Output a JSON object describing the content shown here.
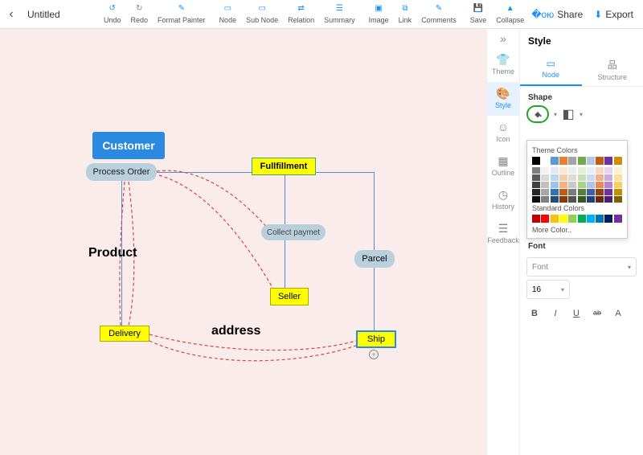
{
  "doc": {
    "title": "Untitled"
  },
  "toolbar": {
    "undo": "Undo",
    "redo": "Redo",
    "format_painter": "Format Painter",
    "node": "Node",
    "sub_node": "Sub Node",
    "relation": "Relation",
    "summary": "Summary",
    "image": "Image",
    "link": "Link",
    "comments": "Comments",
    "save": "Save",
    "collapse": "Collapse",
    "share": "Share",
    "export": "Export"
  },
  "side": {
    "theme": "Theme",
    "style": "Style",
    "icon": "Icon",
    "outline": "Outline",
    "history": "History",
    "feedback": "Feedback"
  },
  "panel": {
    "title": "Style",
    "tab_node": "Node",
    "tab_structure": "Structure",
    "shape_label": "Shape",
    "theme_colors": "Theme Colors",
    "standard_colors": "Standard Colors",
    "more_color": "More Color..",
    "font_label": "Font",
    "font_placeholder": "Font",
    "font_size": "16"
  },
  "nodes": {
    "customer": "Customer",
    "process": "Process Order",
    "fulfill": "Fullfillment",
    "collect": "Collect paymet",
    "seller": "Seller",
    "parcel": "Parcel",
    "delivery": "Delivery",
    "ship": "Ship",
    "product": "Product",
    "address": "address"
  },
  "colors": {
    "theme_row": [
      "#000000",
      "#ffffff",
      "#5b9bd5",
      "#ed7d31",
      "#a5a5a5",
      "#70ad47",
      "#b4c7e7",
      "#c55a11",
      "#7030a0",
      "#d08e00"
    ],
    "theme_shades": [
      [
        "#7f7f7f",
        "#f2f2f2",
        "#deebf7",
        "#fbe5d6",
        "#ededed",
        "#e2f0d9",
        "#e9eef8",
        "#f7d6c4",
        "#e6d5ef",
        "#fdf2d0"
      ],
      [
        "#595959",
        "#d9d9d9",
        "#bdd7ee",
        "#f8cbad",
        "#dbdbdb",
        "#c5e0b4",
        "#cdd9ee",
        "#efb08a",
        "#ccabe0",
        "#fae09a"
      ],
      [
        "#404040",
        "#bfbfbf",
        "#9dc3e6",
        "#f4b183",
        "#c9c9c9",
        "#a9d18e",
        "#b0c4e4",
        "#e78b50",
        "#b286cf",
        "#f6cf66"
      ],
      [
        "#262626",
        "#a6a6a6",
        "#2e75b6",
        "#c55a11",
        "#7b7b7b",
        "#548235",
        "#3a62ac",
        "#9c3d0c",
        "#7030a0",
        "#bf8f00"
      ],
      [
        "#0d0d0d",
        "#808080",
        "#1f4e79",
        "#843c0c",
        "#525252",
        "#385723",
        "#24407a",
        "#6a2908",
        "#4a2070",
        "#7f6000"
      ]
    ],
    "standard": [
      "#c00000",
      "#ff0000",
      "#ffc000",
      "#ffff00",
      "#92d050",
      "#00b050",
      "#00b0f0",
      "#0070c0",
      "#002060",
      "#7030a0"
    ]
  }
}
